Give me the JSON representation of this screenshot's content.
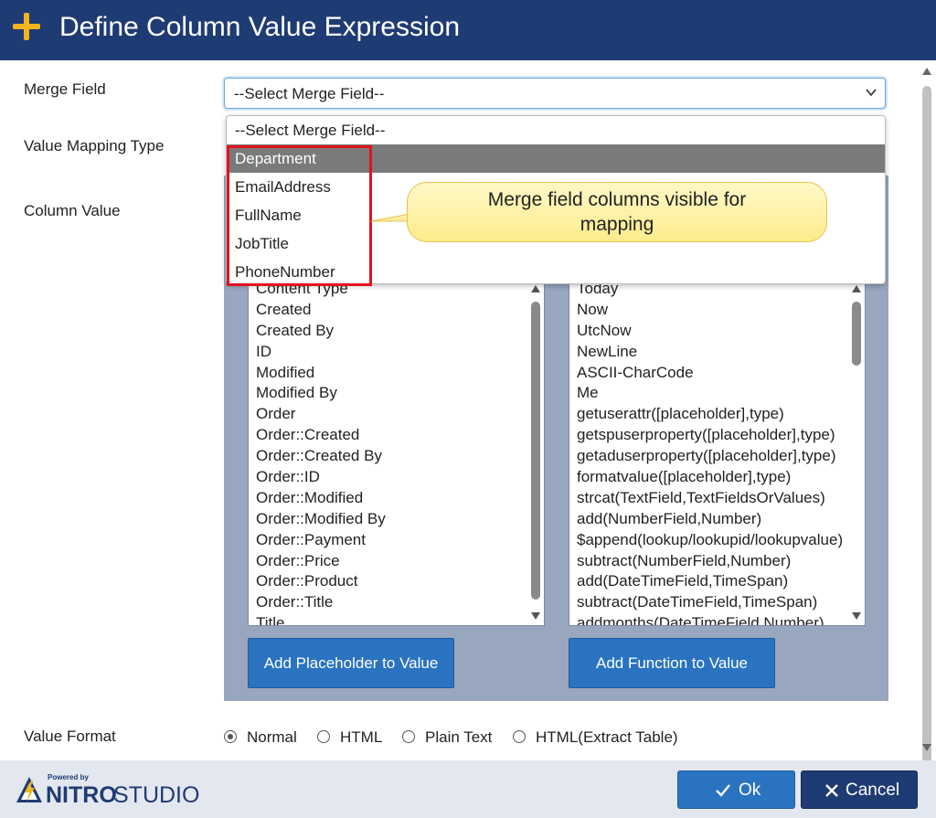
{
  "dialog": {
    "title": "Define Column Value Expression"
  },
  "form": {
    "merge_field_label": "Merge Field",
    "merge_field_value": "--Select Merge Field--",
    "value_mapping_type_label": "Value Mapping Type",
    "column_value_label": "Column Value",
    "value_format_label": "Value Format"
  },
  "merge_field_dropdown": {
    "options": [
      "--Select Merge Field--",
      "Department",
      "EmailAddress",
      "FullName",
      "JobTitle",
      "PhoneNumber"
    ],
    "selected_index": 1
  },
  "callout": {
    "line1": "Merge field columns visible for",
    "line2": "mapping"
  },
  "placeholders": {
    "items": [
      "Content Type",
      "Created",
      "Created By",
      "ID",
      "Modified",
      "Modified By",
      "Order",
      "Order::Created",
      "Order::Created By",
      "Order::ID",
      "Order::Modified",
      "Order::Modified By",
      "Order::Payment",
      "Order::Price",
      "Order::Product",
      "Order::Title",
      "Title"
    ],
    "button_label": "Add Placeholder to Value"
  },
  "functions": {
    "items": [
      "Today",
      "Now",
      "UtcNow",
      "NewLine",
      "ASCII-CharCode",
      "Me",
      "getuserattr([placeholder],type)",
      "getspuserproperty([placeholder],type)",
      "getaduserproperty([placeholder],type)",
      "formatvalue([placeholder],type)",
      "strcat(TextField,TextFieldsOrValues)",
      "add(NumberField,Number)",
      "$append(lookup/lookupid/lookupvalue)",
      "subtract(NumberField,Number)",
      "add(DateTimeField,TimeSpan)",
      "subtract(DateTimeField,TimeSpan)",
      "addmonths(DateTimeField,Number)"
    ],
    "button_label": "Add Function to Value"
  },
  "value_format": {
    "options": [
      "Normal",
      "HTML",
      "Plain Text",
      "HTML(Extract Table)"
    ],
    "selected": "Normal"
  },
  "footer": {
    "powered_by": "Powered by",
    "brand_nitro": "NITRO",
    "brand_studio": "STUDIO",
    "ok_label": "Ok",
    "cancel_label": "Cancel"
  },
  "colors": {
    "header": "#1f3b73",
    "accent": "#f2b51d",
    "button_blue": "#2a73c0",
    "panel": "#98a6be",
    "highlight": "#e0141e"
  },
  "icons": [
    "plus-icon",
    "chevron-down-icon",
    "check-icon",
    "close-icon",
    "nitro-logo-icon"
  ]
}
